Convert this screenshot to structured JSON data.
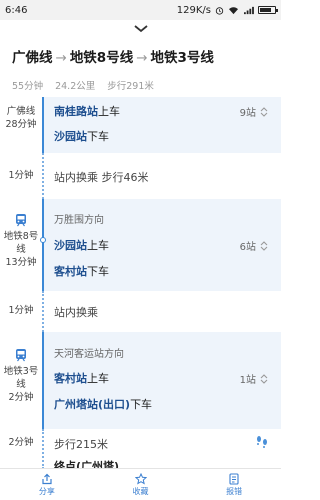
{
  "status": {
    "time": "6:46",
    "speed": "129K/s"
  },
  "route": {
    "lines": [
      "广佛线",
      "地铁8号线",
      "地铁3号线"
    ],
    "arrow": "→",
    "duration": "55分钟",
    "distance": "24.2公里",
    "walk": "步行291米"
  },
  "segments": {
    "gf": {
      "line": "广佛线",
      "time": "28分钟",
      "board": "南桂路站",
      "board_suffix": "上车",
      "alight": "沙园站",
      "alight_suffix": "下车",
      "stops": "9站"
    },
    "t1": {
      "time": "1分钟",
      "text": "站内换乘 步行46米"
    },
    "m8": {
      "line": "地铁8号线",
      "time": "13分钟",
      "direction": "万胜围方向",
      "board": "沙园站",
      "board_suffix": "上车",
      "alight": "客村站",
      "alight_suffix": "下车",
      "stops": "6站"
    },
    "t2": {
      "time": "1分钟",
      "text": "站内换乘"
    },
    "m3": {
      "line": "地铁3号线",
      "time": "2分钟",
      "direction": "天河客运站方向",
      "board": "客村站",
      "board_suffix": "上车",
      "alight": "广州塔站(出口)",
      "alight_suffix": "下车",
      "stops": "1站"
    },
    "walk": {
      "time": "2分钟",
      "text": "步行215米"
    },
    "last": {
      "text": "终点(广州塔)"
    }
  },
  "tabs": [
    {
      "label": "分享",
      "icon": "share-icon"
    },
    {
      "label": "收藏",
      "icon": "star-icon"
    },
    {
      "label": "报错",
      "icon": "report-icon"
    }
  ],
  "colors": {
    "accent": "#3b88d6",
    "card": "#eef4fb"
  }
}
